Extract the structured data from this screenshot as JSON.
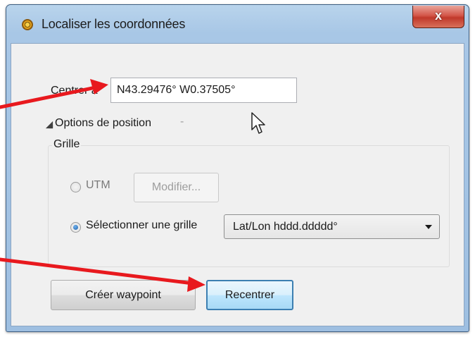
{
  "window": {
    "title": "Localiser les coordonnées",
    "close_label": "x",
    "icon": "app-icon"
  },
  "center": {
    "label": "Centrer à",
    "value": "N43.29476° W0.37505°"
  },
  "options": {
    "label": "Options de position",
    "dash": "-",
    "expanded": true
  },
  "grid": {
    "title": "Grille",
    "utm_label": "UTM",
    "utm_selected": false,
    "modify_label": "Modifier...",
    "modify_enabled": false,
    "select_grid_label": "Sélectionner une grille",
    "select_grid_selected": true,
    "grid_value": "Lat/Lon hddd.ddddd°"
  },
  "buttons": {
    "create_waypoint": "Créer waypoint",
    "recenter": "Recentrer"
  },
  "annotation_color": "#e8191e"
}
